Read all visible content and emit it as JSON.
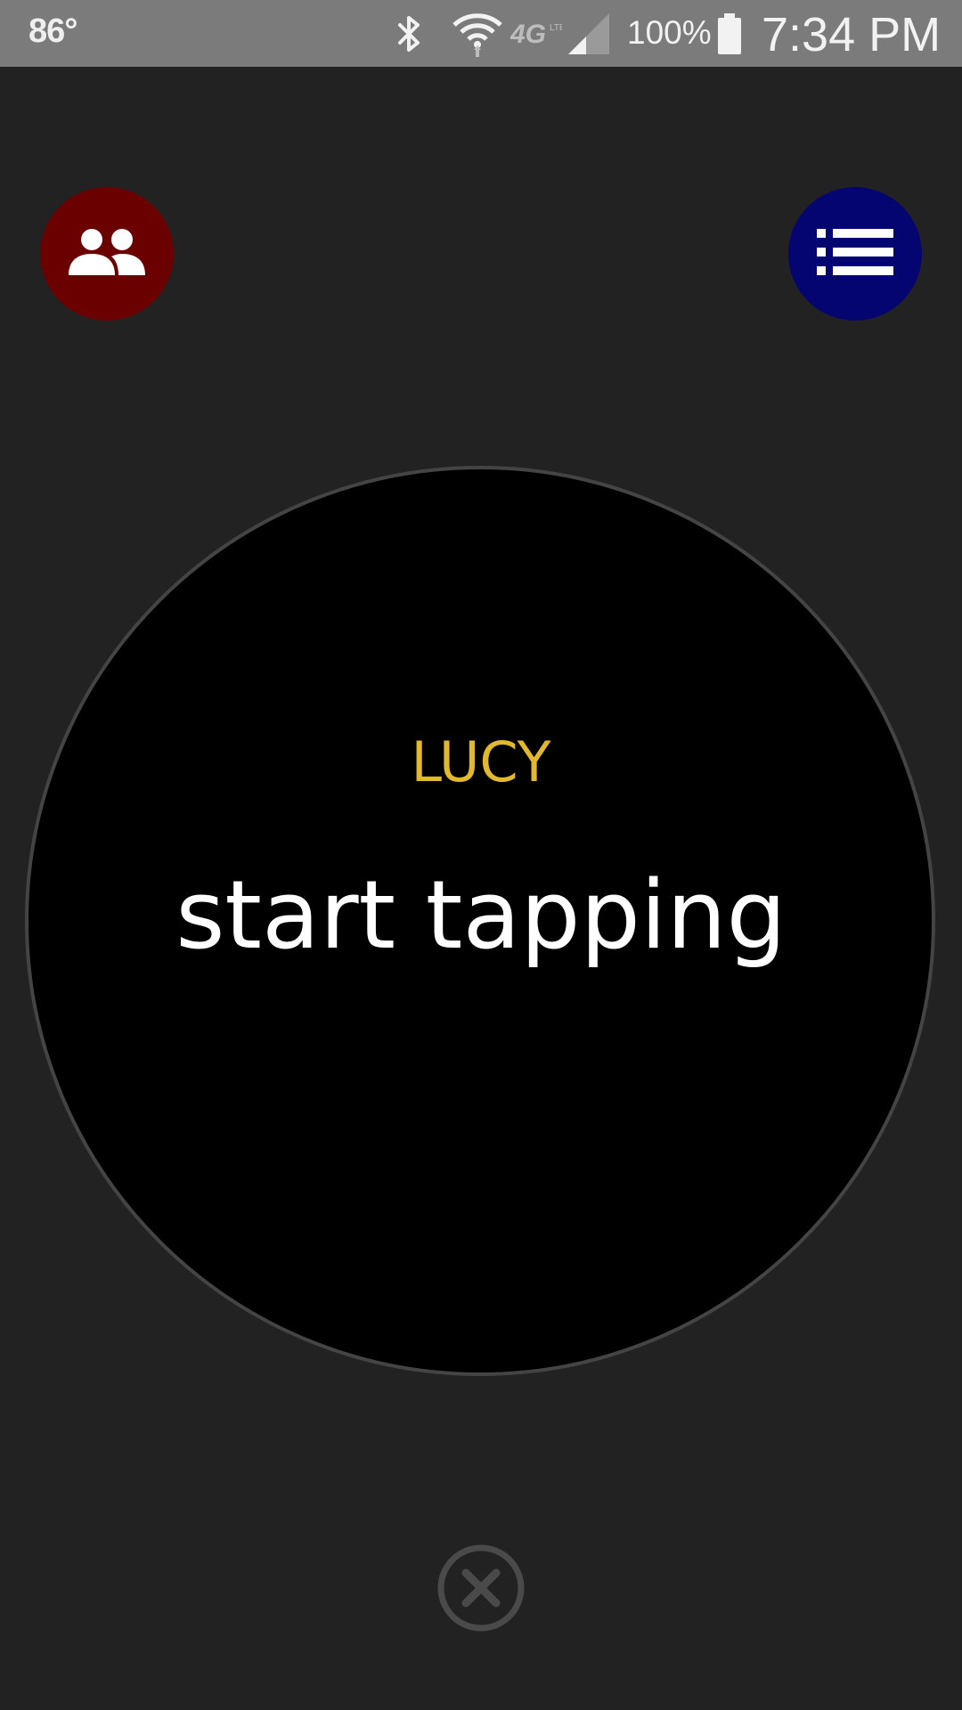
{
  "status_bar": {
    "temperature": "86°",
    "battery_percent": "100%",
    "time": "7:34 PM",
    "icons": [
      "bluetooth-icon",
      "wifi-icon",
      "lte-icon",
      "signal-icon",
      "battery-icon"
    ]
  },
  "toolbar": {
    "left_button_icon": "people-icon",
    "left_button_color": "#6b0000",
    "right_button_icon": "list-icon",
    "right_button_color": "#050571"
  },
  "tap_area": {
    "player_name": "LUCY",
    "prompt": "start tapping",
    "name_color": "#e2b82e"
  },
  "footer": {
    "close_icon": "close-circle-icon"
  }
}
